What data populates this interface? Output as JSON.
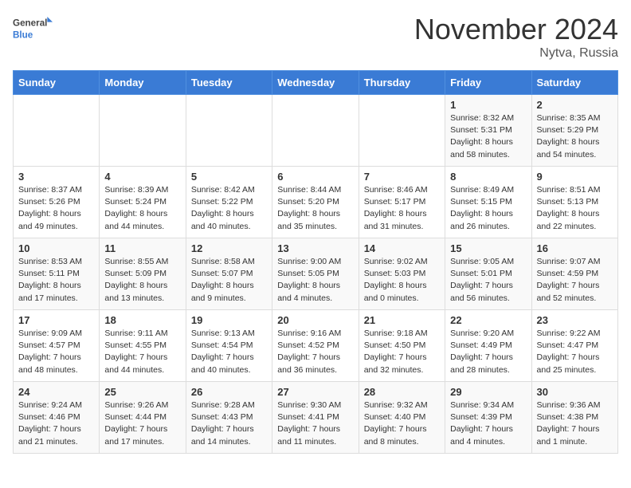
{
  "header": {
    "logo_general": "General",
    "logo_blue": "Blue",
    "month_title": "November 2024",
    "location": "Nytva, Russia"
  },
  "weekdays": [
    "Sunday",
    "Monday",
    "Tuesday",
    "Wednesday",
    "Thursday",
    "Friday",
    "Saturday"
  ],
  "weeks": [
    [
      {
        "day": "",
        "info": ""
      },
      {
        "day": "",
        "info": ""
      },
      {
        "day": "",
        "info": ""
      },
      {
        "day": "",
        "info": ""
      },
      {
        "day": "",
        "info": ""
      },
      {
        "day": "1",
        "info": "Sunrise: 8:32 AM\nSunset: 5:31 PM\nDaylight: 8 hours\nand 58 minutes."
      },
      {
        "day": "2",
        "info": "Sunrise: 8:35 AM\nSunset: 5:29 PM\nDaylight: 8 hours\nand 54 minutes."
      }
    ],
    [
      {
        "day": "3",
        "info": "Sunrise: 8:37 AM\nSunset: 5:26 PM\nDaylight: 8 hours\nand 49 minutes."
      },
      {
        "day": "4",
        "info": "Sunrise: 8:39 AM\nSunset: 5:24 PM\nDaylight: 8 hours\nand 44 minutes."
      },
      {
        "day": "5",
        "info": "Sunrise: 8:42 AM\nSunset: 5:22 PM\nDaylight: 8 hours\nand 40 minutes."
      },
      {
        "day": "6",
        "info": "Sunrise: 8:44 AM\nSunset: 5:20 PM\nDaylight: 8 hours\nand 35 minutes."
      },
      {
        "day": "7",
        "info": "Sunrise: 8:46 AM\nSunset: 5:17 PM\nDaylight: 8 hours\nand 31 minutes."
      },
      {
        "day": "8",
        "info": "Sunrise: 8:49 AM\nSunset: 5:15 PM\nDaylight: 8 hours\nand 26 minutes."
      },
      {
        "day": "9",
        "info": "Sunrise: 8:51 AM\nSunset: 5:13 PM\nDaylight: 8 hours\nand 22 minutes."
      }
    ],
    [
      {
        "day": "10",
        "info": "Sunrise: 8:53 AM\nSunset: 5:11 PM\nDaylight: 8 hours\nand 17 minutes."
      },
      {
        "day": "11",
        "info": "Sunrise: 8:55 AM\nSunset: 5:09 PM\nDaylight: 8 hours\nand 13 minutes."
      },
      {
        "day": "12",
        "info": "Sunrise: 8:58 AM\nSunset: 5:07 PM\nDaylight: 8 hours\nand 9 minutes."
      },
      {
        "day": "13",
        "info": "Sunrise: 9:00 AM\nSunset: 5:05 PM\nDaylight: 8 hours\nand 4 minutes."
      },
      {
        "day": "14",
        "info": "Sunrise: 9:02 AM\nSunset: 5:03 PM\nDaylight: 8 hours\nand 0 minutes."
      },
      {
        "day": "15",
        "info": "Sunrise: 9:05 AM\nSunset: 5:01 PM\nDaylight: 7 hours\nand 56 minutes."
      },
      {
        "day": "16",
        "info": "Sunrise: 9:07 AM\nSunset: 4:59 PM\nDaylight: 7 hours\nand 52 minutes."
      }
    ],
    [
      {
        "day": "17",
        "info": "Sunrise: 9:09 AM\nSunset: 4:57 PM\nDaylight: 7 hours\nand 48 minutes."
      },
      {
        "day": "18",
        "info": "Sunrise: 9:11 AM\nSunset: 4:55 PM\nDaylight: 7 hours\nand 44 minutes."
      },
      {
        "day": "19",
        "info": "Sunrise: 9:13 AM\nSunset: 4:54 PM\nDaylight: 7 hours\nand 40 minutes."
      },
      {
        "day": "20",
        "info": "Sunrise: 9:16 AM\nSunset: 4:52 PM\nDaylight: 7 hours\nand 36 minutes."
      },
      {
        "day": "21",
        "info": "Sunrise: 9:18 AM\nSunset: 4:50 PM\nDaylight: 7 hours\nand 32 minutes."
      },
      {
        "day": "22",
        "info": "Sunrise: 9:20 AM\nSunset: 4:49 PM\nDaylight: 7 hours\nand 28 minutes."
      },
      {
        "day": "23",
        "info": "Sunrise: 9:22 AM\nSunset: 4:47 PM\nDaylight: 7 hours\nand 25 minutes."
      }
    ],
    [
      {
        "day": "24",
        "info": "Sunrise: 9:24 AM\nSunset: 4:46 PM\nDaylight: 7 hours\nand 21 minutes."
      },
      {
        "day": "25",
        "info": "Sunrise: 9:26 AM\nSunset: 4:44 PM\nDaylight: 7 hours\nand 17 minutes."
      },
      {
        "day": "26",
        "info": "Sunrise: 9:28 AM\nSunset: 4:43 PM\nDaylight: 7 hours\nand 14 minutes."
      },
      {
        "day": "27",
        "info": "Sunrise: 9:30 AM\nSunset: 4:41 PM\nDaylight: 7 hours\nand 11 minutes."
      },
      {
        "day": "28",
        "info": "Sunrise: 9:32 AM\nSunset: 4:40 PM\nDaylight: 7 hours\nand 8 minutes."
      },
      {
        "day": "29",
        "info": "Sunrise: 9:34 AM\nSunset: 4:39 PM\nDaylight: 7 hours\nand 4 minutes."
      },
      {
        "day": "30",
        "info": "Sunrise: 9:36 AM\nSunset: 4:38 PM\nDaylight: 7 hours\nand 1 minute."
      }
    ]
  ]
}
